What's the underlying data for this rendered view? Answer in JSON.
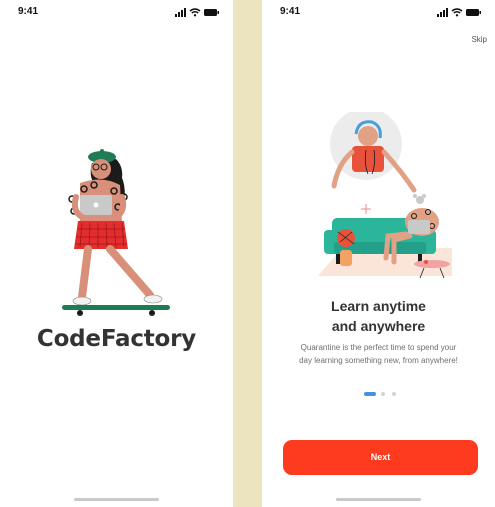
{
  "splash": {
    "status_time": "9:41",
    "brand": "CodeFactory"
  },
  "onboarding": {
    "status_time": "9:41",
    "skip_label": "Skip",
    "title_lines": [
      "Learn anytime",
      "and anywhere"
    ],
    "description_lines": [
      "Quarantine is the perfect time to spend your",
      "day learning something new, from anywhere!"
    ],
    "pager": {
      "total": 3,
      "active": 1
    },
    "next_label": "Next"
  },
  "colors": {
    "accent": "#ff3b1f",
    "active_dot": "#4a90e2",
    "inactive_dot": "#d4d4d4",
    "divider": "#ece4bf",
    "brand_text": "#333333"
  },
  "icons": [
    "signal-icon",
    "wifi-icon",
    "battery-icon"
  ]
}
